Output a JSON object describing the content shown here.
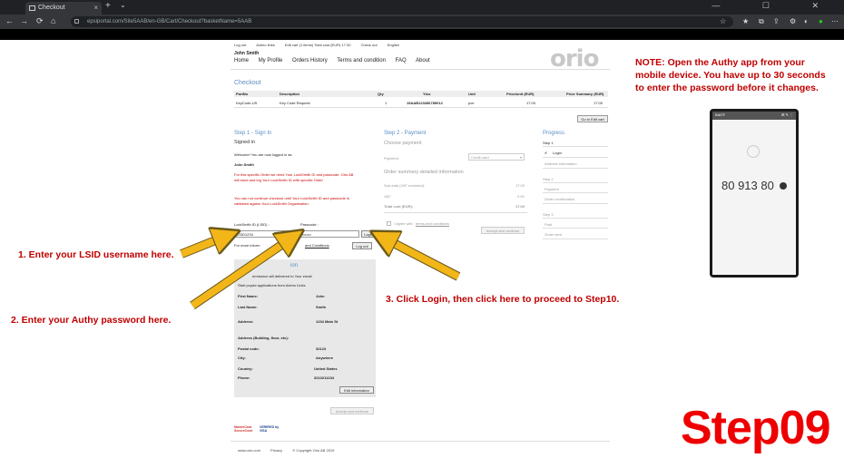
{
  "browser": {
    "tab_title": "Checkout",
    "tab_close": "×",
    "new_tab": "+",
    "tab_menu": "⌄",
    "window_controls": "— ☐ ✕",
    "url": "epsiportal.com/Site5AAB/en-GB/Cart/Checkout?basketName=5AAB",
    "nav": {
      "back": "←",
      "forward": "→",
      "reload": "⟳",
      "home": "⌂"
    }
  },
  "site": {
    "toplinks": [
      "Log out",
      "Actmo links",
      "Edit cart (1 items) Total cost (EUR) 17.00",
      "Check out",
      "English"
    ],
    "username": "John Smith",
    "nav": [
      "Home",
      "My Profile",
      "Orders History",
      "Terms and condition",
      "FAQ",
      "About"
    ],
    "logo": "orio",
    "checkout_title": "Checkout",
    "cart": {
      "headers": [
        "PartNo",
        "Description",
        "Qty",
        "Ylco",
        "Unit",
        "Price/unit (EUR)",
        "Price Summary (EUR)"
      ],
      "row": [
        "KeyCode-US",
        "Key Code Request",
        "1",
        "15AAB123456789012",
        "pce",
        "17.00",
        "17.00"
      ],
      "edit_button": "Go to Edit cart"
    },
    "step1": {
      "title": "Step 1 - Sign In",
      "subtitle": "Signed in",
      "welcome": "Welcome! You are now logged in as",
      "name": "John Smith",
      "red1": "For this specific Order we need Your LockSmith ID and passcode. Orio AB",
      "red2": "will store and log Your LockSmith ID with specific Order.",
      "red3": "You can not continue checkout until Your LockSmith ID and passcode is",
      "red4": "validated agains Your LockSmith Organisation.",
      "lsid_label": "LockSmith ID (LSID) :",
      "passcode_label": "Passcode :",
      "lsid_value": "LSID1234",
      "passcode_value": "•••••••",
      "login_button": "Login",
      "more_info": "For more inform",
      "conditions_link": "and Conditions",
      "logout_button": "Log out"
    },
    "address": {
      "header_suffix": "ion",
      "line1": "ermission will delivered to Your email.",
      "line2": "Start pcpad applications from Actmo Links",
      "first_name_label": "First Name:",
      "first_name": "John",
      "last_name_label": "Last Name:",
      "last_name": "Smith",
      "address_label": "Address:",
      "address": "1234 Main St",
      "address2_label": "Address (Building, floor, etc):",
      "postal_label": "Postal code:",
      "postal": "32123",
      "city_label": "City:",
      "city": "Anywhere",
      "country_label": "Country:",
      "country": "United States",
      "phone_label": "Phone:",
      "phone": "3213211234",
      "edit_button": "Edit information",
      "proceed_button": "Accept and continue"
    },
    "step2": {
      "title": "Step 2 - Payment",
      "subtitle": "Choose payment",
      "payment_label": "Payment:",
      "payment_value": "Credit card",
      "summary_title": "Order summary detailed information",
      "subtotal_label": "Sub-total (VAT excluded):",
      "subtotal": "17.00",
      "vat_label": "VAT:",
      "vat": "0.00",
      "total_label": "Total cost (EUR):",
      "total": "17.00",
      "agree_text": "I agree with",
      "agree_link": "terms and conditions",
      "accept_button": "Accept and continue"
    },
    "progress": {
      "title": "Progress",
      "step1": "Step 1",
      "login": "Login",
      "address_info": "Address information",
      "step2": "Step 2",
      "payment": "Payment",
      "order_conf": "Order confirmation",
      "step3": "Step 3",
      "paid": "Paid",
      "order_sent": "Order sent"
    },
    "payment_logos": {
      "mastercard": "MasterCard SecureCode",
      "visa": "VERIFIED by VISA"
    },
    "footer": [
      "www.orio.com",
      "Privacy",
      "© Copyright Orio AB 2019"
    ]
  },
  "annotations": {
    "note": "NOTE: Open the Authy app from your mobile device. You have up to 30 seconds to enter the password before it changes.",
    "a1": "1. Enter your LSID username here.",
    "a2": "2. Enter your Authy password here.",
    "a3": "3. Click Login, then click here to proceed to Step10.",
    "step": "Step09",
    "arrow_color": "#f2b619"
  },
  "phone": {
    "app_name": "BIATF",
    "icons": "⊞ ✎ ⋮",
    "code": "80 913 80"
  }
}
